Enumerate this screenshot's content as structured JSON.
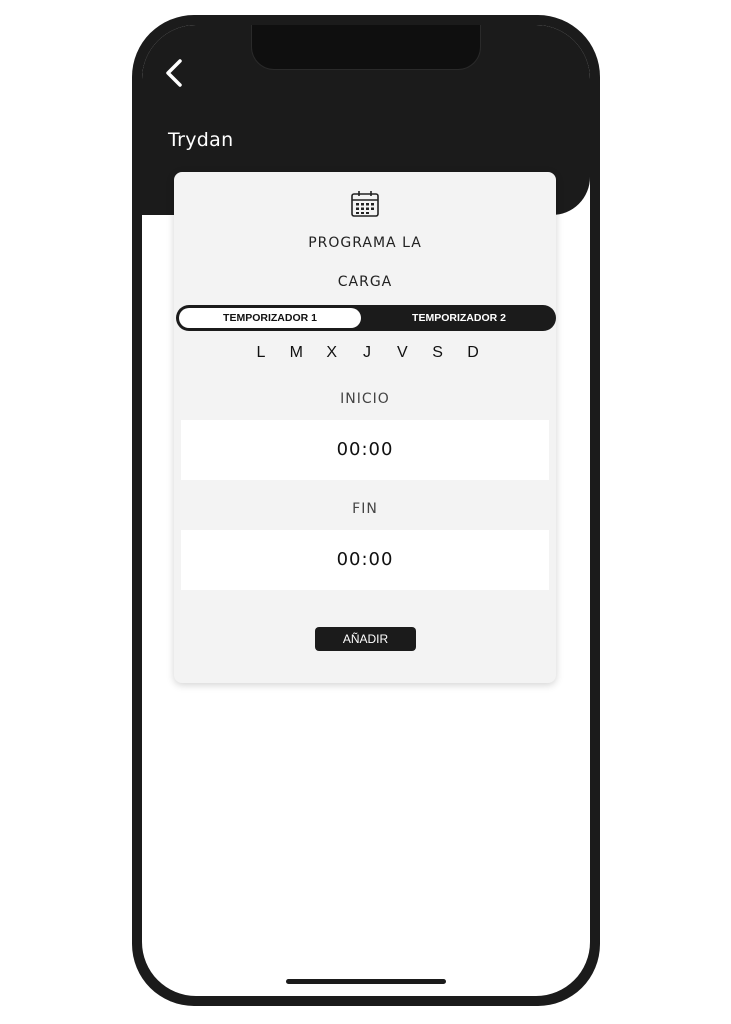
{
  "header": {
    "title": "Trydan",
    "back_icon": "chevron-left-icon"
  },
  "card": {
    "icon": "calendar-icon",
    "title_line1": "PROGRAMA LA",
    "title_line2": "CARGA",
    "tabs": [
      {
        "label": "TEMPORIZADOR 1",
        "selected": true
      },
      {
        "label": "TEMPORIZADOR 2",
        "selected": false
      }
    ],
    "days": [
      "L",
      "M",
      "X",
      "J",
      "V",
      "S",
      "D"
    ],
    "start": {
      "label": "INICIO",
      "value": "00:00"
    },
    "end": {
      "label": "FIN",
      "value": "00:00"
    },
    "add_label": "AÑADIR"
  },
  "colors": {
    "dark": "#1b1b1b",
    "card_bg": "#f3f3f3",
    "white": "#ffffff"
  }
}
